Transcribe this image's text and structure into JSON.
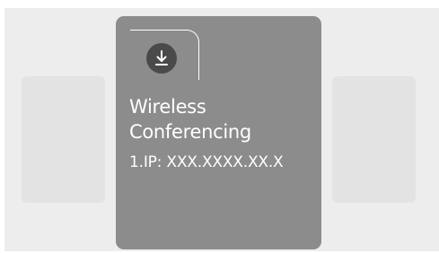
{
  "card": {
    "icon": "download-icon",
    "title_line1": "Wireless",
    "title_line2": "Conferencing",
    "ip_text": "1.IP: XXX.XXXX.XX.X"
  },
  "colors": {
    "background": "#ededed",
    "side_card": "#e3e3e3",
    "main_card": "#8c8c8c",
    "icon_circle": "#4a4a4a",
    "text": "#ffffff"
  }
}
